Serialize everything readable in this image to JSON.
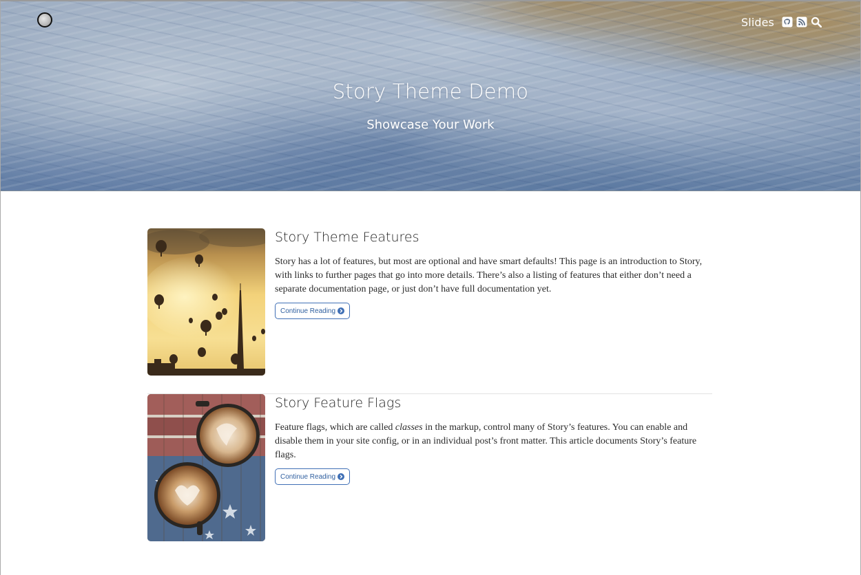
{
  "site": {
    "logo_icon": "moon-avatar-icon"
  },
  "nav": {
    "slides_label": "Slides",
    "icons": [
      "github-icon",
      "rss-icon",
      "search-icon"
    ]
  },
  "hero": {
    "title": "Story Theme Demo",
    "subtitle": "Showcase Your Work"
  },
  "articles": [
    {
      "title": "Story Theme Features",
      "excerpt": "Story has a lot of features, but most are optional and have smart defaults! This page is an introduction to Story, with links to further pages that go into more details. There’s also a listing of features that either don’t need a separate documentation page, or just don’t have full documentation yet.",
      "button_label": "Continue Reading",
      "thumbnail": "hot-air-balloons-image"
    },
    {
      "title": "Story Feature Flags",
      "excerpt_before": "Feature flags, which are called ",
      "excerpt_emphasis": "classes",
      "excerpt_after": " in the markup, control many of Story’s features. You can enable and disable them in your site config, or in an individual post’s front matter. This article documents Story’s feature flags.",
      "button_label": "Continue Reading",
      "thumbnail": "coffee-cups-image"
    }
  ],
  "colors": {
    "button_border": "#3f6fb5",
    "button_text": "#2f5f9f",
    "hero_text": "#ffffff"
  }
}
